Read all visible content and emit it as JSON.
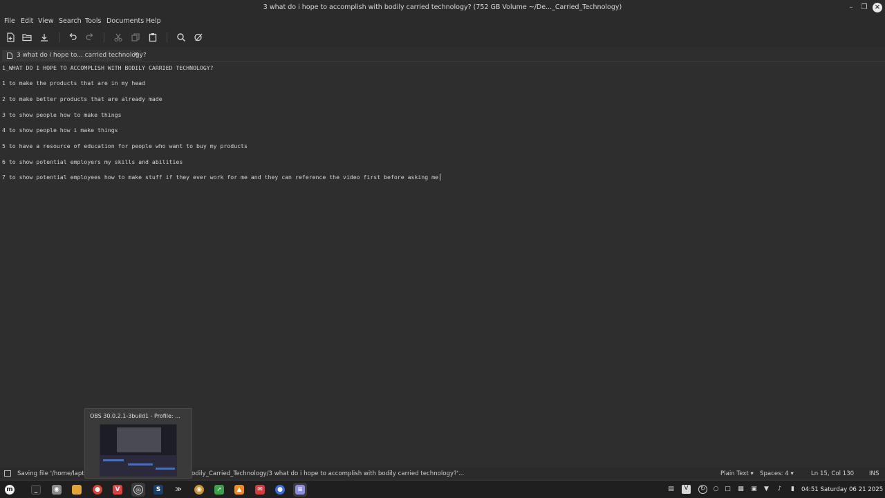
{
  "window": {
    "title": "3 what do i hope to accomplish with bodily carried technology? (752 GB Volume ~/De..._Carried_Technology)",
    "controls": [
      "minimize",
      "maximize",
      "close"
    ]
  },
  "menubar": [
    "File",
    "Edit",
    "View",
    "Search",
    "Tools",
    "Documents",
    "Help"
  ],
  "toolbar": {
    "icons": [
      "new-document-icon",
      "open-folder-icon",
      "save-icon",
      "undo-icon",
      "redo-icon",
      "cut-icon",
      "copy-icon",
      "paste-icon",
      "search-icon",
      "clear-format-icon"
    ]
  },
  "tabs": [
    {
      "label": "3 what do i hope to... carried technology?",
      "active": true
    }
  ],
  "editor": {
    "lines": [
      "1_WHAT DO I HOPE TO ACCOMPLISH WITH BODILY CARRIED TECHNOLOGY?",
      "1 to make the products that are in my head",
      "2 to make better products that are already made",
      "3 to show people how to make things",
      "4 to show people how i make things",
      "5 to have a resource of education for people who want to buy my products",
      "6 to show potential employers my skills and abilities",
      "7 to show potential employees how to make stuff if they ever work for me and they can reference the video first before asking me"
    ]
  },
  "statusbar": {
    "saving_left": "Saving file '/home/lapto",
    "saving_right": "odily_Carried_Technology/3 what do i hope to accomplish with bodily carried technology?'...",
    "language": "Plain Text",
    "spaces": "Spaces: 4",
    "position": "Ln 15, Col 130",
    "mode": "INS"
  },
  "obs_popup": {
    "title": "OBS 30.0.2.1-3build1 - Profile: ..."
  },
  "taskbar": {
    "apps": [
      "menu",
      "terminal",
      "disks",
      "files",
      "chrome",
      "vivaldi",
      "obs",
      "steam",
      "shortcut-launcher",
      "blender",
      "inkscape",
      "vlc",
      "email",
      "chat",
      "text-editor"
    ],
    "tray": [
      "clipboard-icon",
      "vpn-icon",
      "network-icon",
      "update-icon",
      "display-icon",
      "bluetooth-icon",
      "wifi-icon",
      "volume-icon",
      "battery-icon"
    ],
    "clock": "04:51 Saturday 06 21 2025"
  },
  "colors": {
    "background": "#2e2e2e",
    "bar": "#2b2b2b",
    "text": "#d6d6d6",
    "taskbar": "#1f1f1f"
  }
}
